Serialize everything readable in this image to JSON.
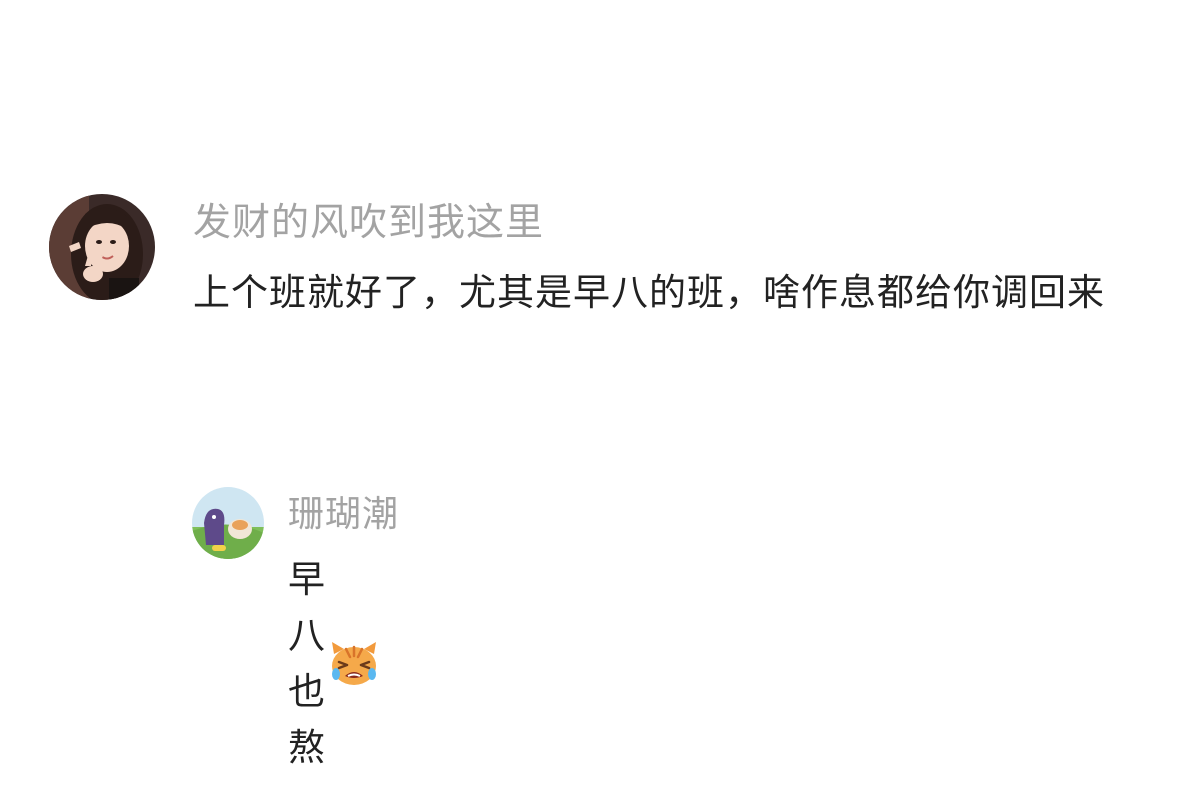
{
  "comments": [
    {
      "username": "发财的风吹到我这里",
      "text": "上个班就好了，尤其是早八的班，啥作息都给你调回来",
      "avatar_icon": "user-photo-avatar"
    }
  ],
  "replies": [
    {
      "username": "珊瑚潮",
      "text": "早八也熬",
      "avatar_icon": "cartoon-avatar",
      "emoji_icon": "crying-cat-emoji"
    }
  ],
  "colors": {
    "username": "#a3a3a3",
    "text": "#222222",
    "background": "#ffffff"
  }
}
